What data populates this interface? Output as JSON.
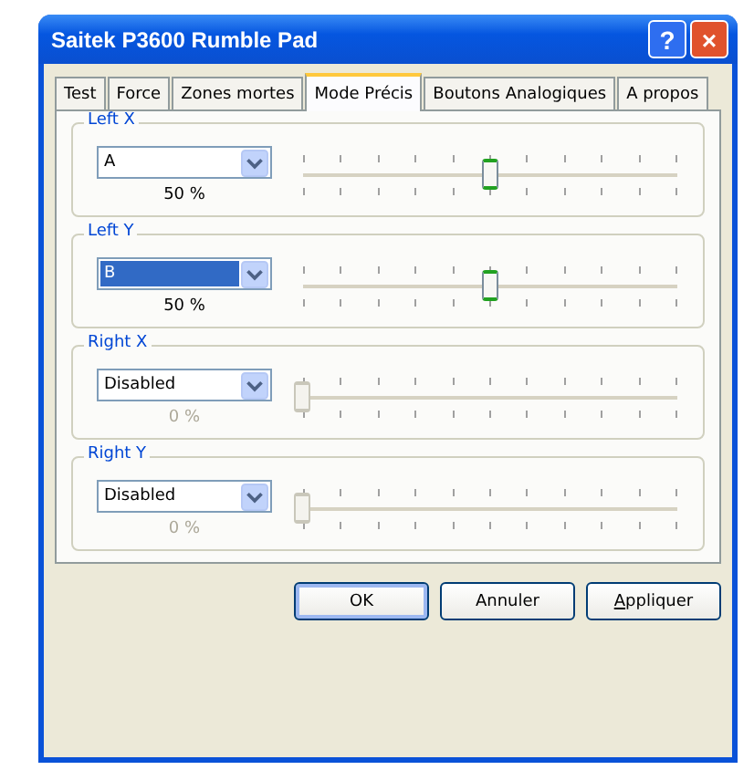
{
  "window": {
    "title": "Saitek P3600 Rumble Pad",
    "buttons": [
      "?",
      "×"
    ]
  },
  "tabs": [
    {
      "label": "Test",
      "selected": false
    },
    {
      "label": "Force",
      "selected": false
    },
    {
      "label": "Zones mortes",
      "selected": false
    },
    {
      "label": "Mode Précis",
      "selected": true
    },
    {
      "label": "Boutons Analogiques",
      "selected": false
    },
    {
      "label": "A propos",
      "selected": false
    }
  ],
  "axes": [
    {
      "label": "Left X",
      "value": "A",
      "focused": false,
      "disabled": false,
      "level": 0.5,
      "reading": "50 %"
    },
    {
      "label": "Left Y",
      "value": "B",
      "focused": true,
      "disabled": false,
      "level": 0.5,
      "reading": "50 %"
    },
    {
      "label": "Right X",
      "value": "Disabled",
      "focused": false,
      "disabled": true,
      "level": 0,
      "reading": "0 %"
    },
    {
      "label": "Right Y",
      "value": "Disabled",
      "focused": false,
      "disabled": true,
      "level": 0,
      "reading": "0 %"
    }
  ],
  "buttons": [
    {
      "label": "OK",
      "default": true,
      "accesskey": false
    },
    {
      "label": "Annuler",
      "default": false,
      "accesskey": false
    },
    {
      "label": "Appliquer",
      "default": false,
      "accesskey": true
    }
  ]
}
